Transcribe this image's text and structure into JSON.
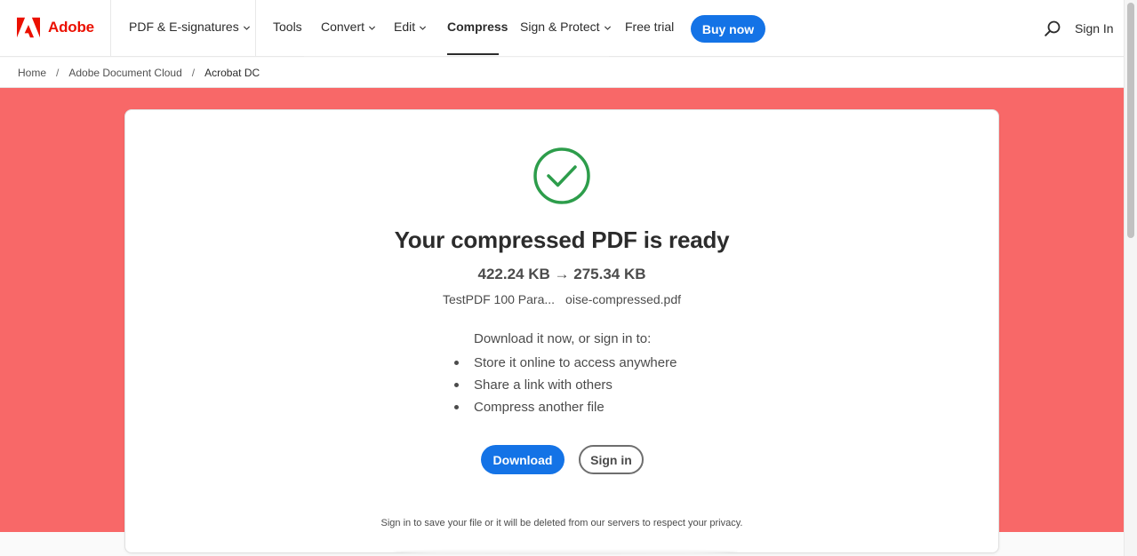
{
  "brand": {
    "name": "Adobe",
    "color": "#eb1000",
    "icon": "adobe-logo-icon"
  },
  "nav": {
    "items": [
      {
        "label": "PDF & E-signatures",
        "has_dropdown": true,
        "active": false
      },
      {
        "label": "Tools",
        "has_dropdown": false,
        "active": false
      },
      {
        "label": "Convert",
        "has_dropdown": true,
        "active": false
      },
      {
        "label": "Edit",
        "has_dropdown": true,
        "active": false
      },
      {
        "label": "Compress",
        "has_dropdown": false,
        "active": true
      },
      {
        "label": "Sign & Protect",
        "has_dropdown": true,
        "active": false
      },
      {
        "label": "Free trial",
        "has_dropdown": false,
        "active": false
      }
    ],
    "buy_now_label": "Buy now",
    "search_icon": "search-icon",
    "sign_in_label": "Sign In"
  },
  "breadcrumb": {
    "items": [
      "Home",
      "Adobe Document Cloud",
      "Acrobat DC"
    ],
    "separator": "/"
  },
  "colors": {
    "accent": "#1473e6",
    "hero_background": "#f86868",
    "success": "#2d9d4b"
  },
  "result": {
    "status_icon": "check-circle-icon",
    "title": "Your compressed PDF is ready",
    "original_size": "422.24 KB",
    "arrow": "→",
    "compressed_size": "275.34 KB",
    "file_name_start": "TestPDF 100 Para...",
    "file_name_end": "oise-compressed.pdf",
    "intro": "Download it now, or sign in to:",
    "benefits": [
      "Store it online to access anywhere",
      "Share a link with others",
      "Compress another file"
    ],
    "download_label": "Download",
    "sign_in_label": "Sign in",
    "privacy_note": "Sign in to save your file or it will be deleted from our servers to respect your privacy."
  }
}
